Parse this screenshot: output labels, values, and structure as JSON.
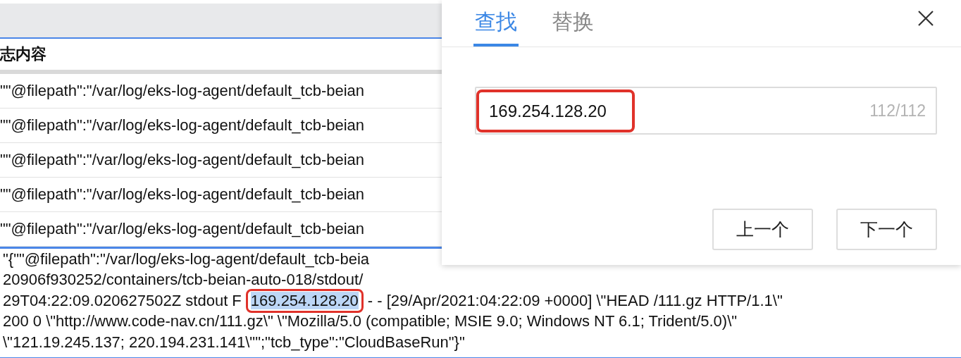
{
  "log_table": {
    "header": "志内容",
    "rows": [
      {
        "text": "\"\"@filepath\":\"/var/log/eks-log-agent/default_tcb-beian"
      },
      {
        "text": "\"\"@filepath\":\"/var/log/eks-log-agent/default_tcb-beian"
      },
      {
        "text": "\"\"@filepath\":\"/var/log/eks-log-agent/default_tcb-beian"
      },
      {
        "text": "\"\"@filepath\":\"/var/log/eks-log-agent/default_tcb-beian"
      },
      {
        "text": "\"\"@filepath\":\"/var/log/eks-log-agent/default_tcb-beian"
      }
    ]
  },
  "log_detail": {
    "lines": [
      {
        "kind": "plain",
        "text": "\"{\"\"@filepath\":\"/var/log/eks-log-agent/default_tcb-beia"
      },
      {
        "kind": "plain",
        "text": "20906f930252/containers/tcb-beian-auto-018/stdout/"
      },
      {
        "kind": "match",
        "before": "29T04:22:09.020627502Z stdout F",
        "match": "169.254.128.20",
        "after": "- - [29/Apr/2021:04:22:09 +0000] \\\"HEAD /111.gz HTTP/1.1\\\""
      },
      {
        "kind": "plain",
        "text": "200 0 \\\"http://www.code-nav.cn/111.gz\\\" \\\"Mozilla/5.0 (compatible; MSIE 9.0; Windows NT 6.1; Trident/5.0)\\\""
      },
      {
        "kind": "plain",
        "text": "\\\"121.19.245.137; 220.194.231.141\\\"\";\"tcb_type\":\"CloudBaseRun\"}\""
      }
    ]
  },
  "find_dialog": {
    "tabs": [
      {
        "label": "查找",
        "selected": true
      },
      {
        "label": "替换",
        "selected": false
      }
    ],
    "search": {
      "value": "169.254.128.20",
      "count": "112/112"
    },
    "buttons": [
      "上一个",
      "下一个"
    ]
  }
}
